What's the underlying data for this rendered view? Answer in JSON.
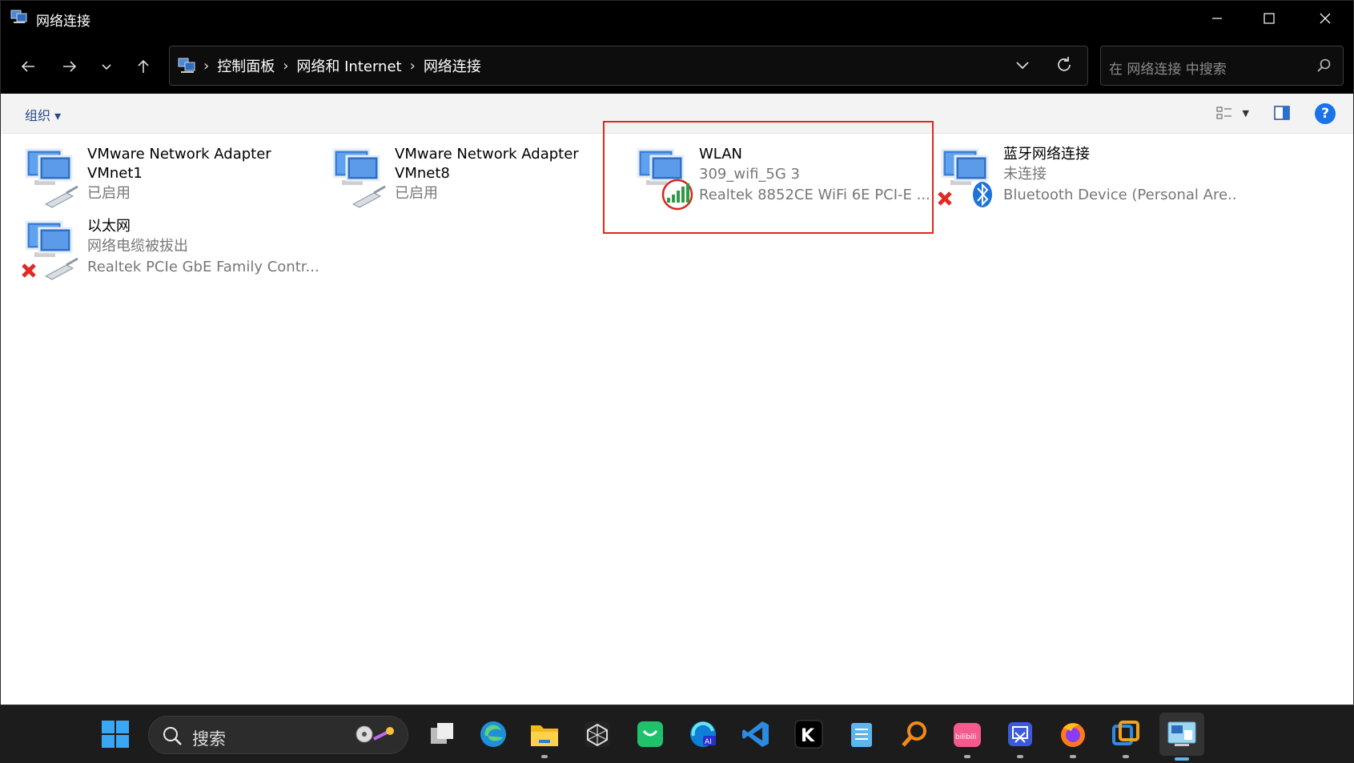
{
  "window": {
    "title": "网络连接",
    "controls": {
      "minimize": "minimize",
      "maximize": "maximize",
      "close": "close"
    }
  },
  "address": {
    "crumbs": [
      "控制面板",
      "网络和 Internet",
      "网络连接"
    ],
    "search_placeholder": "在 网络连接 中搜索"
  },
  "toolbar": {
    "organize_label": "组织"
  },
  "connections": [
    {
      "name": "VMware Network Adapter VMnet1",
      "status": "已启用",
      "device": ""
    },
    {
      "name": "VMware Network Adapter VMnet8",
      "status": "已启用",
      "device": ""
    },
    {
      "name": "WLAN",
      "status": "309_wifi_5G 3",
      "device": "Realtek 8852CE WiFi 6E PCI-E ..."
    },
    {
      "name": "蓝牙网络连接",
      "status": "未连接",
      "device": "Bluetooth Device (Personal Are..."
    },
    {
      "name": "以太网",
      "status": "网络电缆被拔出",
      "device": "Realtek PCIe GbE Family Contr..."
    }
  ],
  "taskbar": {
    "search_placeholder": "搜索"
  },
  "colors": {
    "highlight": "#e0271c",
    "accent": "#1a73e8"
  }
}
